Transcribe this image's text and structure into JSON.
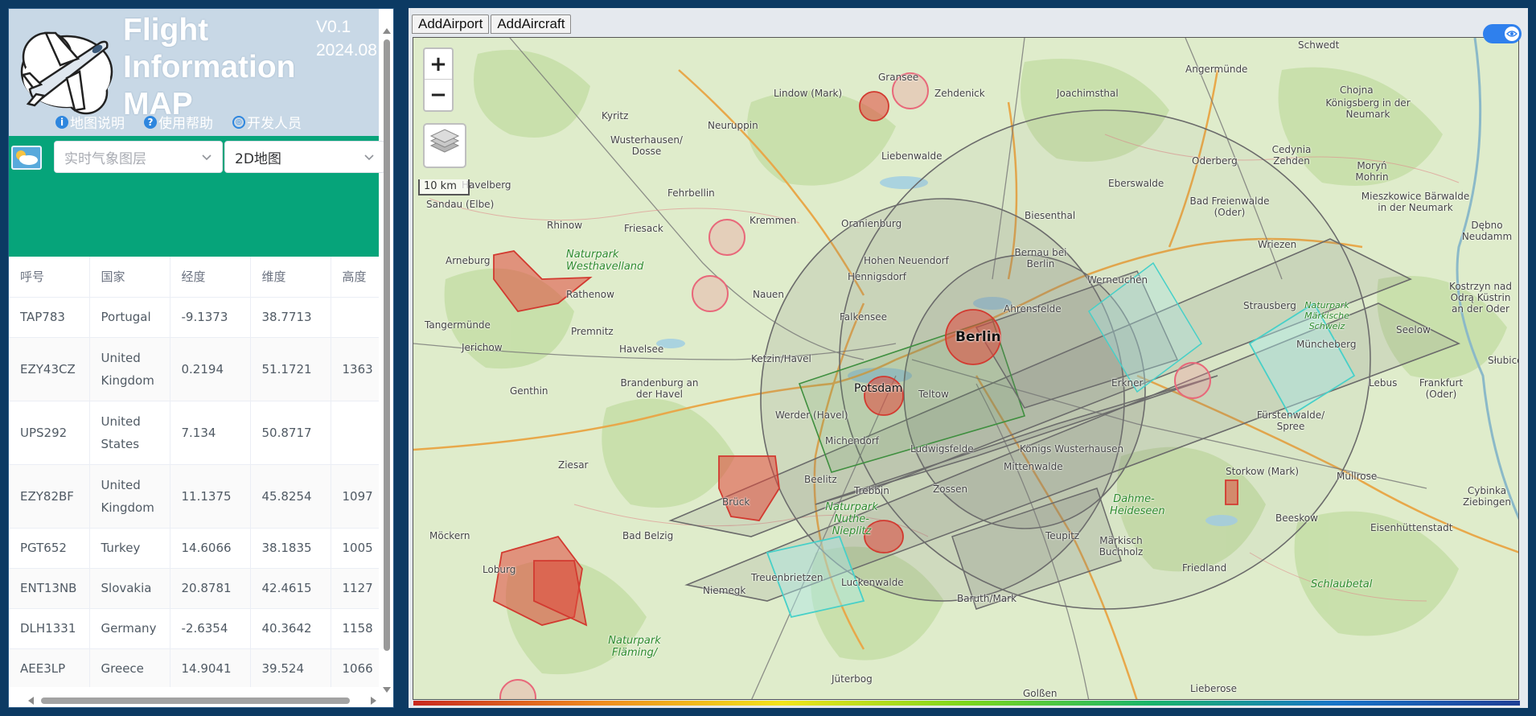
{
  "app": {
    "title": "Flight Information MAP",
    "version": "V0.1",
    "date": "2024.08"
  },
  "help_links": [
    {
      "label": "地图说明",
      "icon": "info-icon"
    },
    {
      "label": "使用帮助",
      "icon": "help-icon"
    },
    {
      "label": "开发人员",
      "icon": "developers-icon"
    }
  ],
  "controls": {
    "weather_layer_placeholder": "实时气象图层",
    "map_type_value": "2D地图"
  },
  "table": {
    "columns": [
      "呼号",
      "国家",
      "经度",
      "维度",
      "高度"
    ],
    "rows": [
      {
        "callsign": "TAP783",
        "country": "Portugal",
        "lon": "-9.1373",
        "lat": "38.7713",
        "alt": ""
      },
      {
        "callsign": "EZY43CZ",
        "country": "United Kingdom",
        "lon": "0.2194",
        "lat": "51.1721",
        "alt": "1363"
      },
      {
        "callsign": "UPS292",
        "country": "United States",
        "lon": "7.134",
        "lat": "50.8717",
        "alt": ""
      },
      {
        "callsign": "EZY82BF",
        "country": "United Kingdom",
        "lon": "11.1375",
        "lat": "45.8254",
        "alt": "1097"
      },
      {
        "callsign": "PGT652",
        "country": "Turkey",
        "lon": "14.6066",
        "lat": "38.1835",
        "alt": "1005"
      },
      {
        "callsign": "ENT13NB",
        "country": "Slovakia",
        "lon": "20.8781",
        "lat": "42.4615",
        "alt": "1127"
      },
      {
        "callsign": "DLH1331",
        "country": "Germany",
        "lon": "-2.6354",
        "lat": "40.3642",
        "alt": "1158"
      },
      {
        "callsign": "AEE3LP",
        "country": "Greece",
        "lon": "14.9041",
        "lat": "39.524",
        "alt": "1066"
      }
    ]
  },
  "map_tabs": [
    "AddAirport",
    "AddAircraft"
  ],
  "map": {
    "zoom_in_label": "+",
    "zoom_out_label": "−",
    "scale_label": "10 km",
    "places": [
      {
        "name": "Berlin",
        "kind": "big"
      },
      {
        "name": "Potsdam",
        "kind": "normal"
      },
      {
        "name": "Schwedt",
        "kind": "small"
      },
      {
        "name": "Angermünde",
        "kind": "small"
      },
      {
        "name": "Gransee",
        "kind": "small"
      },
      {
        "name": "Zehdenick",
        "kind": "small"
      },
      {
        "name": "Joachimsthal",
        "kind": "small"
      },
      {
        "name": "Chojna",
        "kind": "small"
      },
      {
        "name": "Königsberg in der Neumark",
        "kind": "small"
      },
      {
        "name": "Lindow (Mark)",
        "kind": "small"
      },
      {
        "name": "Kyritz",
        "kind": "small"
      },
      {
        "name": "Neuruppin",
        "kind": "small"
      },
      {
        "name": "Wusterhausen/ Dosse",
        "kind": "small"
      },
      {
        "name": "Liebenwalde",
        "kind": "small"
      },
      {
        "name": "Oderberg",
        "kind": "small"
      },
      {
        "name": "Cedynia Zehden",
        "kind": "small"
      },
      {
        "name": "Moryń Mohrin",
        "kind": "small"
      },
      {
        "name": "Eberswalde",
        "kind": "small"
      },
      {
        "name": "Bad Freienwalde (Oder)",
        "kind": "small"
      },
      {
        "name": "Mieszkowice Bärwalde in der Neumark",
        "kind": "small"
      },
      {
        "name": "Dębno Neudamm",
        "kind": "small"
      },
      {
        "name": "Fehrbellin",
        "kind": "small"
      },
      {
        "name": "Kremmen",
        "kind": "small"
      },
      {
        "name": "Oranienburg",
        "kind": "small"
      },
      {
        "name": "Biesenthal",
        "kind": "small"
      },
      {
        "name": "Wriezen",
        "kind": "small"
      },
      {
        "name": "Havelberg",
        "kind": "small"
      },
      {
        "name": "Sandau (Elbe)",
        "kind": "small"
      },
      {
        "name": "Rhinow",
        "kind": "small"
      },
      {
        "name": "Friesack",
        "kind": "small"
      },
      {
        "name": "Bernau bei Berlin",
        "kind": "small"
      },
      {
        "name": "Hohen Neuendorf",
        "kind": "small"
      },
      {
        "name": "Arneburg",
        "kind": "small"
      },
      {
        "name": "Naturpark Westhavelland",
        "kind": "park"
      },
      {
        "name": "Hennigsdorf",
        "kind": "small"
      },
      {
        "name": "Werneuchen",
        "kind": "small"
      },
      {
        "name": "Rathenow",
        "kind": "small"
      },
      {
        "name": "Nauen",
        "kind": "small"
      },
      {
        "name": "Strausberg",
        "kind": "small"
      },
      {
        "name": "Naturpark Märkische Schweiz",
        "kind": "park"
      },
      {
        "name": "Kostrzyn nad Odrą Küstrin an der Oder",
        "kind": "small"
      },
      {
        "name": "Tangermünde",
        "kind": "small"
      },
      {
        "name": "Falkensee",
        "kind": "small"
      },
      {
        "name": "Ahrensfelde",
        "kind": "small"
      },
      {
        "name": "Premnitz",
        "kind": "small"
      },
      {
        "name": "Müncheberg",
        "kind": "small"
      },
      {
        "name": "Seelow",
        "kind": "small"
      },
      {
        "name": "Jerichow",
        "kind": "small"
      },
      {
        "name": "Havelsee",
        "kind": "small"
      },
      {
        "name": "Ketzin/Havel",
        "kind": "small"
      },
      {
        "name": "Erkner",
        "kind": "small"
      },
      {
        "name": "Lebus",
        "kind": "small"
      },
      {
        "name": "Słubice",
        "kind": "small"
      },
      {
        "name": "Genthin",
        "kind": "small"
      },
      {
        "name": "Brandenburg an der Havel",
        "kind": "small"
      },
      {
        "name": "Teltow",
        "kind": "small"
      },
      {
        "name": "Frankfurt (Oder)",
        "kind": "small"
      },
      {
        "name": "Werder (Havel)",
        "kind": "small"
      },
      {
        "name": "Fürstenwalde/ Spree",
        "kind": "small"
      },
      {
        "name": "Michendorf",
        "kind": "small"
      },
      {
        "name": "Ludwigsfelde",
        "kind": "small"
      },
      {
        "name": "Königs Wusterhausen",
        "kind": "small"
      },
      {
        "name": "Ziesar",
        "kind": "small"
      },
      {
        "name": "Mittenwalde",
        "kind": "small"
      },
      {
        "name": "Beelitz",
        "kind": "small"
      },
      {
        "name": "Storkow (Mark)",
        "kind": "small"
      },
      {
        "name": "Müllrose",
        "kind": "small"
      },
      {
        "name": "Brück",
        "kind": "small"
      },
      {
        "name": "Trebbin",
        "kind": "small"
      },
      {
        "name": "Zossen",
        "kind": "small"
      },
      {
        "name": "Dahme-Heideseen",
        "kind": "park"
      },
      {
        "name": "Naturpark Nuthe-Nieplitz",
        "kind": "park"
      },
      {
        "name": "Cybinka Ziebingen",
        "kind": "small"
      },
      {
        "name": "Möckern",
        "kind": "small"
      },
      {
        "name": "Bad Belzig",
        "kind": "small"
      },
      {
        "name": "Teupitz",
        "kind": "small"
      },
      {
        "name": "Märkisch Buchholz",
        "kind": "small"
      },
      {
        "name": "Beeskow",
        "kind": "small"
      },
      {
        "name": "Eisenhüttenstadt",
        "kind": "small"
      },
      {
        "name": "Loburg",
        "kind": "small"
      },
      {
        "name": "Treuenbrietzen",
        "kind": "small"
      },
      {
        "name": "Luckenwalde",
        "kind": "small"
      },
      {
        "name": "Friedland",
        "kind": "small"
      },
      {
        "name": "Niemegk",
        "kind": "small"
      },
      {
        "name": "Baruth/Mark",
        "kind": "small"
      },
      {
        "name": "Schlaubetal",
        "kind": "park"
      },
      {
        "name": "Naturpark Fläming/",
        "kind": "park"
      },
      {
        "name": "Jüterbog",
        "kind": "small"
      },
      {
        "name": "Golßen",
        "kind": "small"
      },
      {
        "name": "Lieberose",
        "kind": "small"
      }
    ]
  },
  "colors": {
    "header_bg": "#c8d8e6",
    "controls_bar": "#06a47a",
    "restricted_zone": "#e0483c",
    "airport_circle": "#f28a94",
    "page_bg": "#0c3a63"
  }
}
